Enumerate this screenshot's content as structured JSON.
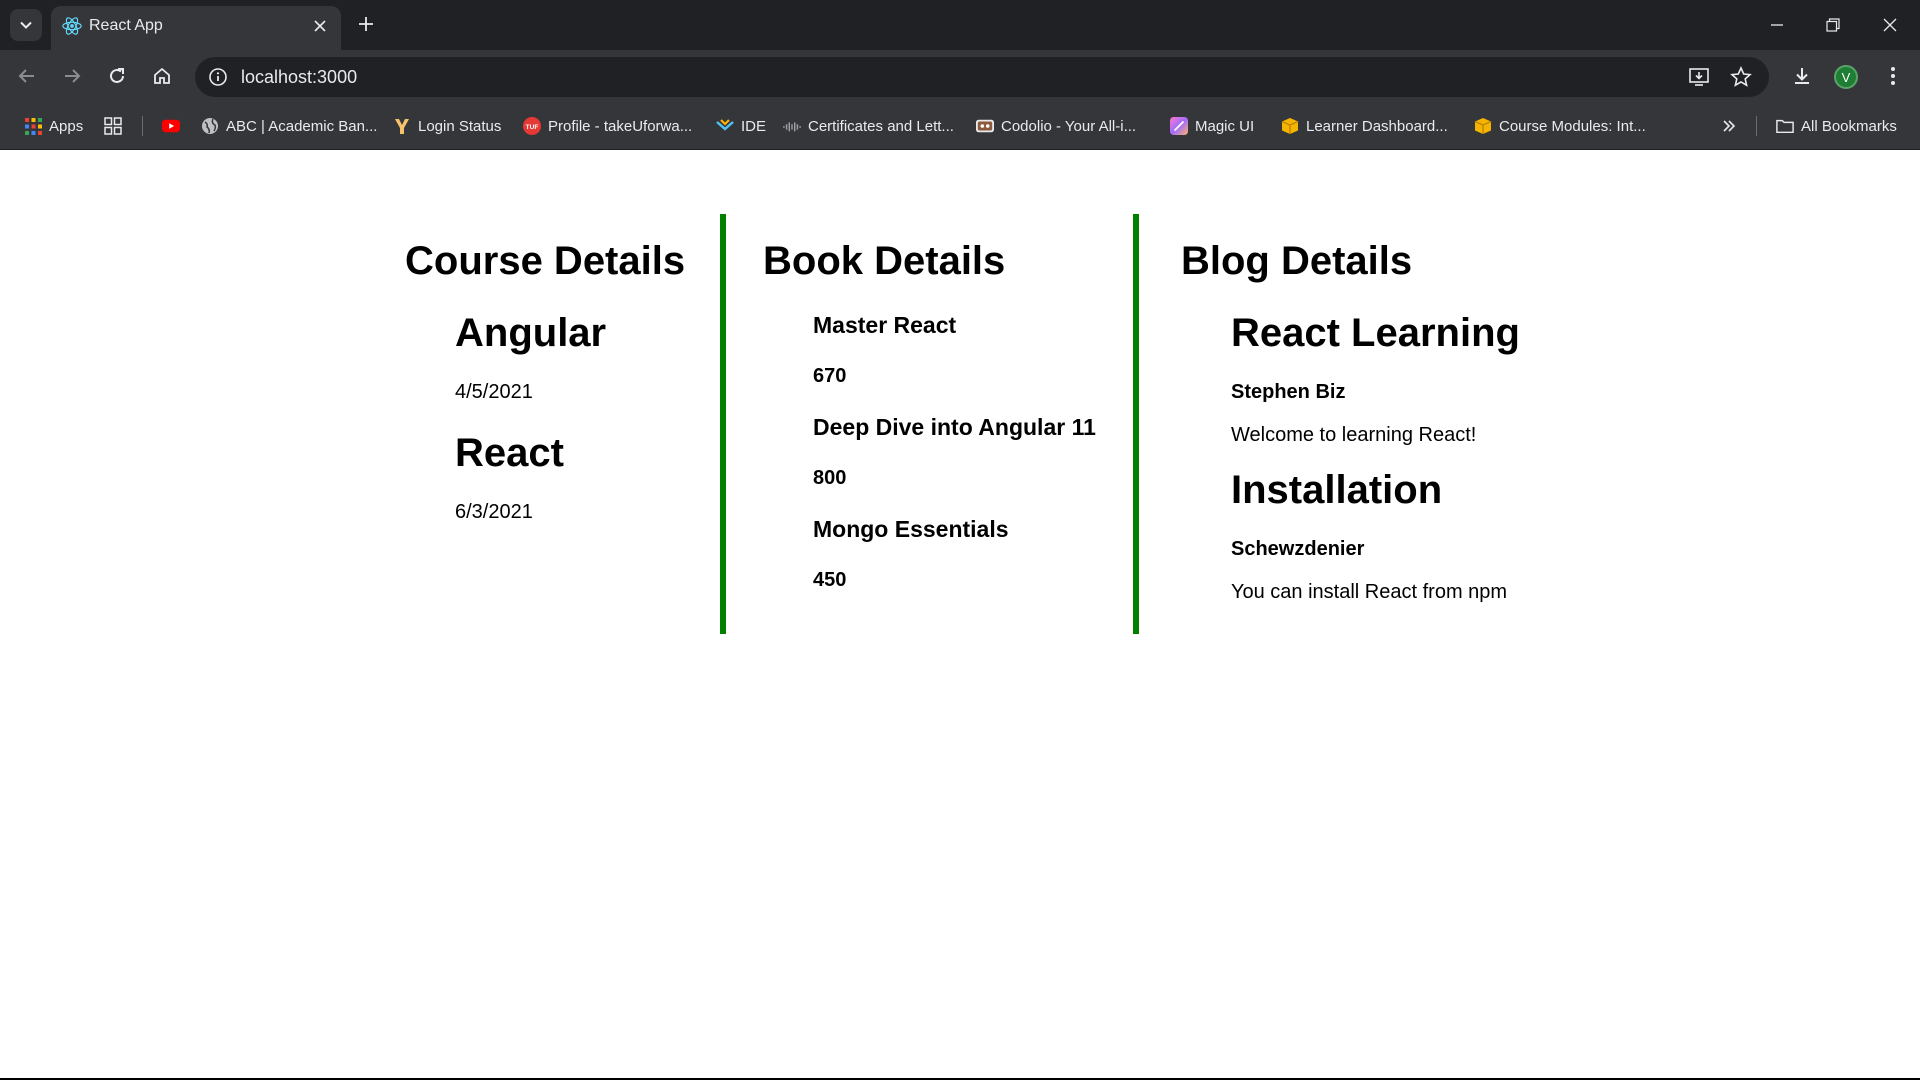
{
  "browser": {
    "tab": {
      "title": "React App"
    },
    "address": {
      "url": "localhost:3000"
    },
    "profile_initial": "V",
    "bookmarks": [
      {
        "label": "Apps",
        "icon": "apps-grid-icon"
      },
      {
        "label": "",
        "icon": "tab-groups-icon"
      },
      {
        "label": "",
        "icon": "youtube-icon"
      },
      {
        "label": "ABC | Academic Ban...",
        "icon": "globe-icon"
      },
      {
        "label": "Login Status",
        "icon": "login-status-icon"
      },
      {
        "label": "Profile - takeUforwa...",
        "icon": "tuf-icon"
      },
      {
        "label": "IDE",
        "icon": "ide-icon"
      },
      {
        "label": "Certificates and Lett...",
        "icon": "cisco-icon"
      },
      {
        "label": "Codolio - Your All-i...",
        "icon": "codolio-icon"
      },
      {
        "label": "Magic UI",
        "icon": "magic-ui-icon"
      },
      {
        "label": "Learner Dashboard...",
        "icon": "box-icon"
      },
      {
        "label": "Course Modules: Int...",
        "icon": "box-icon"
      }
    ],
    "all_bookmarks": "All Bookmarks"
  },
  "page": {
    "course": {
      "heading": "Course Details",
      "items": [
        {
          "name": "Angular",
          "date": "4/5/2021"
        },
        {
          "name": "React",
          "date": "6/3/2021"
        }
      ]
    },
    "book": {
      "heading": "Book Details",
      "items": [
        {
          "name": "Master React",
          "price": "670"
        },
        {
          "name": "Deep Dive into Angular 11",
          "price": "800"
        },
        {
          "name": "Mongo Essentials",
          "price": "450"
        }
      ]
    },
    "blog": {
      "heading": "Blog Details",
      "items": [
        {
          "title": "React Learning",
          "author": "Stephen Biz",
          "content": "Welcome to learning React!"
        },
        {
          "title": "Installation",
          "author": "Schewzdenier",
          "content": "You can install React from npm"
        }
      ]
    },
    "colors": {
      "divider": "#008000",
      "chrome_dark": "#202124",
      "chrome_mid": "#35363a"
    }
  }
}
